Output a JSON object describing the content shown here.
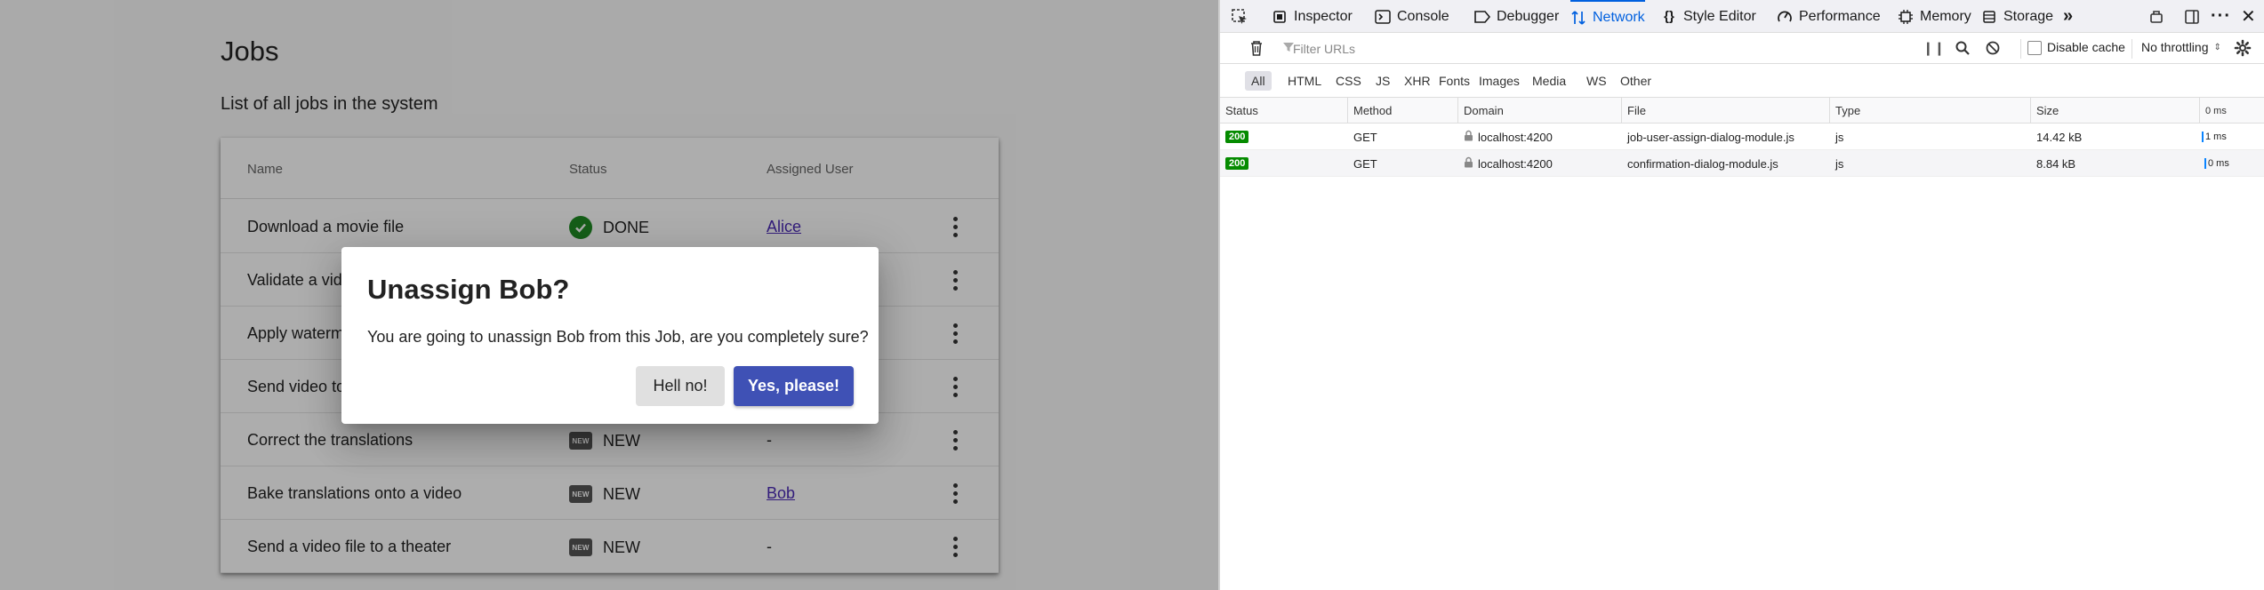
{
  "app": {
    "title": "Jobs",
    "subtitle": "List of all jobs in the system",
    "columns": {
      "name": "Name",
      "status": "Status",
      "user": "Assigned User"
    },
    "rows": [
      {
        "name": "Download a movie file",
        "status": "DONE",
        "status_icon": "check-circle-icon",
        "user": "Alice",
        "user_link": true
      },
      {
        "name": "Validate a video",
        "status": "",
        "status_icon": "",
        "user": "",
        "user_link": false
      },
      {
        "name": "Apply watermark",
        "status": "",
        "status_icon": "",
        "user": "",
        "user_link": false
      },
      {
        "name": "Send video to",
        "status": "",
        "status_icon": "",
        "user": "",
        "user_link": false
      },
      {
        "name": "Correct the translations",
        "status": "NEW",
        "status_icon": "new-badge-icon",
        "user": "-",
        "user_link": false
      },
      {
        "name": "Bake translations onto a video",
        "status": "NEW",
        "status_icon": "new-badge-icon",
        "user": "Bob",
        "user_link": true
      },
      {
        "name": "Send a video file to a theater",
        "status": "NEW",
        "status_icon": "new-badge-icon",
        "user": "-",
        "user_link": false
      }
    ],
    "new_icon_text": "NEW"
  },
  "dialog": {
    "title": "Unassign Bob?",
    "message": "You are going to unassign Bob from this Job, are you completely sure?",
    "cancel_label": "Hell no!",
    "confirm_label": "Yes, please!"
  },
  "devtools": {
    "tabs": [
      {
        "label": "Inspector",
        "icon": "inspector-icon",
        "active": false
      },
      {
        "label": "Console",
        "icon": "console-icon",
        "active": false
      },
      {
        "label": "Debugger",
        "icon": "debugger-icon",
        "active": false
      },
      {
        "label": "Network",
        "icon": "network-icon",
        "active": true
      },
      {
        "label": "Style Editor",
        "icon": "style-editor-icon",
        "active": false
      },
      {
        "label": "Performance",
        "icon": "performance-icon",
        "active": false
      },
      {
        "label": "Memory",
        "icon": "memory-icon",
        "active": false
      },
      {
        "label": "Storage",
        "icon": "storage-icon",
        "active": false
      }
    ],
    "filter_placeholder": "Filter URLs",
    "disable_cache_label": "Disable cache",
    "throttling_label": "No throttling",
    "type_filters": [
      "All",
      "HTML",
      "CSS",
      "JS",
      "XHR",
      "Fonts",
      "Images",
      "Media",
      "WS",
      "Other"
    ],
    "columns": [
      "Status",
      "Method",
      "Domain",
      "File",
      "Type",
      "Size"
    ],
    "waterfall_label": "0 ms",
    "requests": [
      {
        "status": "200",
        "method": "GET",
        "domain": "localhost:4200",
        "file": "job-user-assign-dialog-module.js",
        "type": "js",
        "size": "14.42 kB",
        "time": "1 ms"
      },
      {
        "status": "200",
        "method": "GET",
        "domain": "localhost:4200",
        "file": "confirmation-dialog-module.js",
        "type": "js",
        "size": "8.84 kB",
        "time": "0 ms"
      }
    ]
  }
}
